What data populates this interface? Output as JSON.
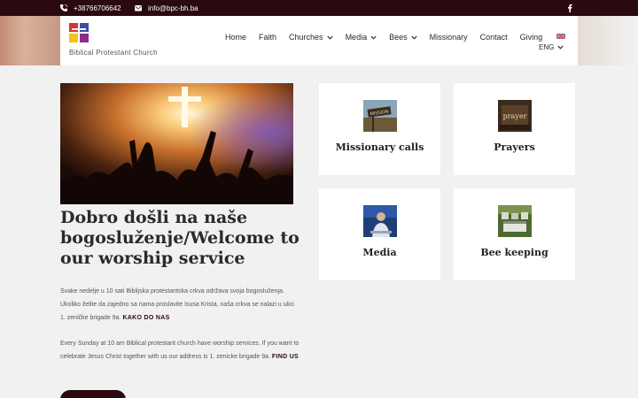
{
  "topbar": {
    "phone": "+38766706642",
    "email": "info@bpc-bh.ba",
    "icons": {
      "phone": "phone-icon",
      "email": "mail-icon",
      "social": "facebook-icon"
    }
  },
  "header": {
    "brand": "Biblical Protestant Church",
    "nav": [
      "Home",
      "Faith",
      "Churches",
      "Media",
      "Bees",
      "Missionary",
      "Contact",
      "Giving"
    ],
    "language": "ENG"
  },
  "main": {
    "title": "Dobro došli na naše bogosluženje/Welcome to our worship service",
    "para1_text": "Svake nedelje u 10 sati Biblijska protestantska crkva održava svoja bogosluženja. Ukoliko želite da zajedno sa nama proslavite Isusa Krista, naša crkva se nalazi u ulici 1. zeničke brigade 9a.",
    "para1_link": "KAKO DO NAS",
    "para2_text": "Every Sunday at 10 am Biblical protestant church have worship services. If you want to celebrate Jesus Christ together with us our address is 1. zenicke brigade 9a.",
    "para2_link": "FIND US"
  },
  "cards": [
    {
      "label": "Missionary calls",
      "sign": "MISSION"
    },
    {
      "label": "Prayers",
      "sign": "prayer"
    },
    {
      "label": "Media"
    },
    {
      "label": "Bee keeping"
    }
  ],
  "colors": {
    "brand_dark": "#2a0a0e",
    "background": "#f2f1f1"
  }
}
